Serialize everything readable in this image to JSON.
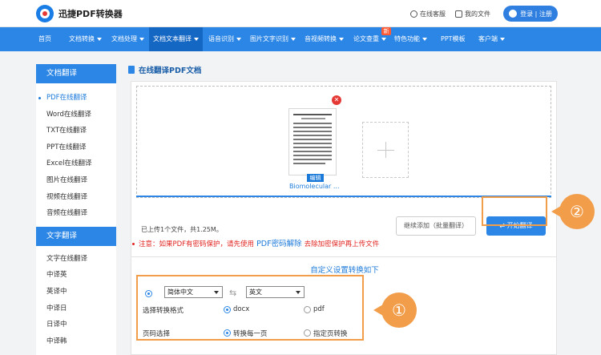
{
  "header": {
    "logo_text": "迅捷PDF转换器",
    "service_label": "在线客服",
    "files_label": "我的文件",
    "login_label": "登录 | 注册"
  },
  "nav": {
    "items": [
      {
        "label": "首页",
        "caret": false
      },
      {
        "label": "文档转换",
        "caret": true
      },
      {
        "label": "文档处理",
        "caret": true
      },
      {
        "label": "文档文本翻译",
        "caret": true,
        "active": true
      },
      {
        "label": "语音识别",
        "caret": true
      },
      {
        "label": "图片文字识别",
        "caret": true
      },
      {
        "label": "音视频转换",
        "caret": true
      },
      {
        "label": "论文查重",
        "caret": true
      },
      {
        "label": "特色功能",
        "caret": true
      },
      {
        "label": "PPT模板",
        "caret": false
      },
      {
        "label": "客户端",
        "caret": true
      }
    ],
    "new_badge": "新"
  },
  "sidebar": {
    "doc_section_title": "文档翻译",
    "doc_items": [
      "PDF在线翻译",
      "Word在线翻译",
      "TXT在线翻译",
      "PPT在线翻译",
      "Excel在线翻译",
      "图片在线翻译",
      "视频在线翻译",
      "音频在线翻译"
    ],
    "text_section_title": "文字翻译",
    "text_items": [
      "文字在线翻译",
      "中译英",
      "英译中",
      "中译日",
      "日译中",
      "中译韩"
    ]
  },
  "main": {
    "page_title": "在线翻译PDF文档",
    "file_name": "Biomolecular ...",
    "edit_label": "编辑",
    "delete_glyph": "✕",
    "status_text": "已上传1个文件，共1.25M。",
    "continue_button": "继续添加（批量翻译）",
    "start_button": "开始翻译",
    "notice_prefix": "注意：如果PDF有密码保护，请先使用",
    "notice_link": "PDF密码解除",
    "notice_suffix": "去除加密保护再上传文件"
  },
  "settings": {
    "title": "自定义设置转换如下",
    "source_lang": "简体中文",
    "target_lang": "英文",
    "format_label": "选择转换格式",
    "format_options": [
      "docx",
      "pdf"
    ],
    "format_selected": "docx",
    "page_label": "页码选择",
    "page_options": [
      "转换每一页",
      "指定页转换"
    ],
    "page_selected": "转换每一页"
  },
  "callouts": {
    "one": "①",
    "two": "②"
  },
  "colors": {
    "brand_blue": "#2b86e6",
    "accent_orange": "#f29d49",
    "warning_red": "#e0241f"
  }
}
